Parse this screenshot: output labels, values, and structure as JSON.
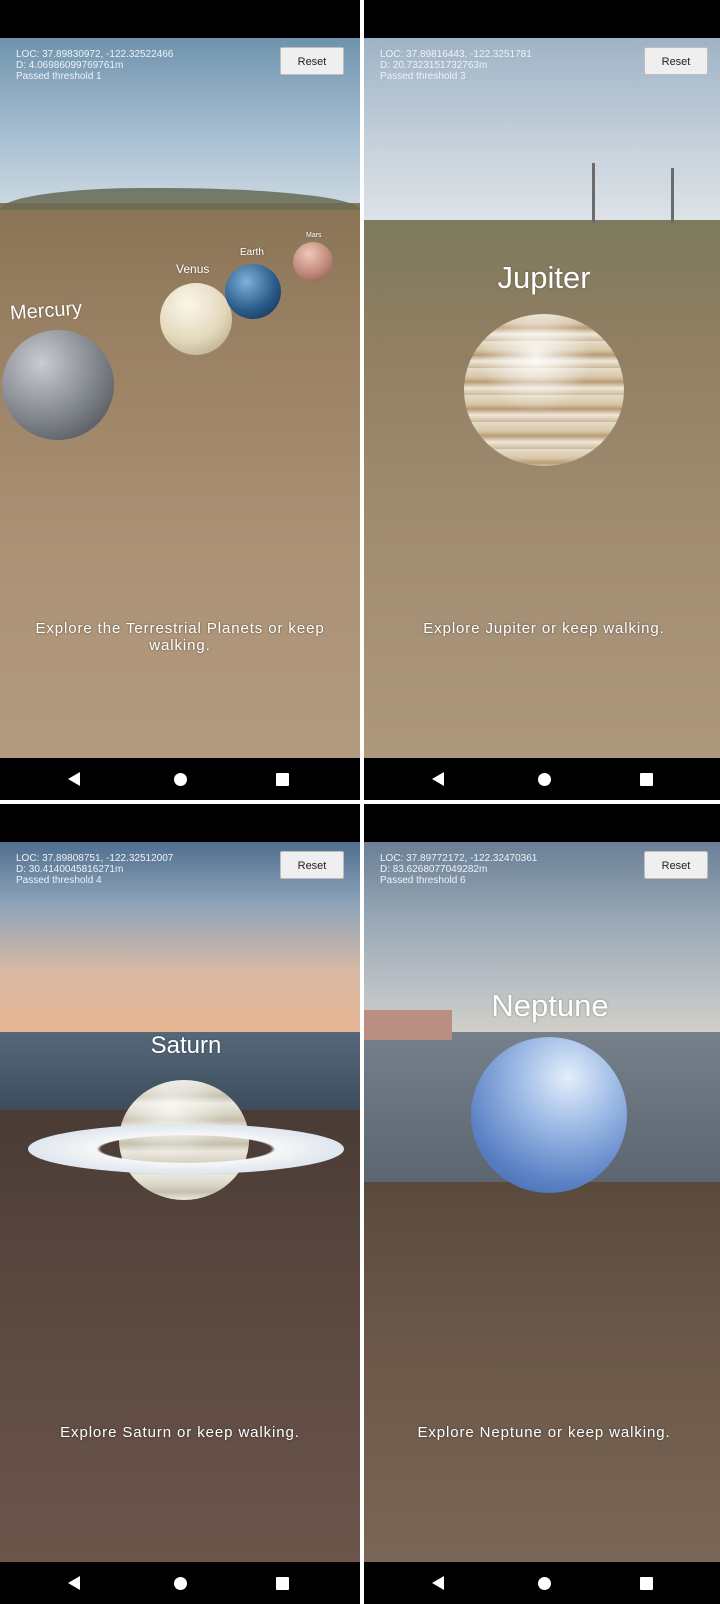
{
  "buttons": {
    "reset_label": "Reset"
  },
  "panels": [
    {
      "loc": "LOC: 37.89830972, -122.32522466",
      "distance": "D: 4.06986099769761m",
      "threshold": "Passed threshold 1",
      "planets": [
        "Mercury",
        "Venus",
        "Earth",
        "Mars"
      ],
      "message": "Explore  the Terrestrial Planets or keep walking."
    },
    {
      "loc": "LOC: 37.89816443, -122.3251781",
      "distance": "D: 20.7323151732763m",
      "threshold": "Passed threshold 3",
      "planets": [
        "Jupiter"
      ],
      "message": "Explore  Jupiter or keep walking."
    },
    {
      "loc": "LOC: 37.89808751, -122.32512007",
      "distance": "D: 30.4140045816271m",
      "threshold": "Passed threshold 4",
      "planets": [
        "Saturn"
      ],
      "message": "Explore  Saturn or keep walking."
    },
    {
      "loc": "LOC: 37.89772172, -122.32470361",
      "distance": "D: 83.6268077049282m",
      "threshold": "Passed threshold 6",
      "planets": [
        "Neptune"
      ],
      "message": "Explore  Neptune or keep walking."
    }
  ],
  "icons": [
    "back-icon",
    "home-icon",
    "recent-apps-icon"
  ]
}
